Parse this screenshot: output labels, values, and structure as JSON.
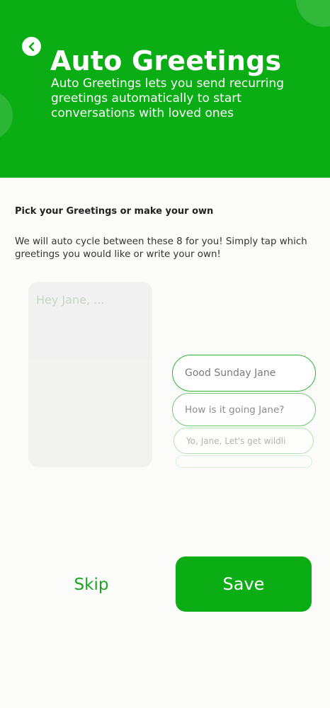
{
  "header": {
    "title": "Auto Greetings",
    "subtitle": "Auto Greetings lets you send recurring greetings automatically to start conversations with loved ones",
    "back_icon": "chevron-left-icon",
    "accent_color": "#0aad14"
  },
  "content": {
    "section_title": "Pick your Greetings or make your own",
    "section_description": "We will auto cycle between these 8 for you! Simply tap which greetings you would like or write your own!",
    "custom_greeting_placeholder": "Hey Jane, ...",
    "greetings": [
      "Good Sunday Jane",
      "How is it going Jane?",
      "Yo, Jane, Let's get wildli",
      ""
    ]
  },
  "actions": {
    "skip_label": "Skip",
    "save_label": "Save"
  }
}
